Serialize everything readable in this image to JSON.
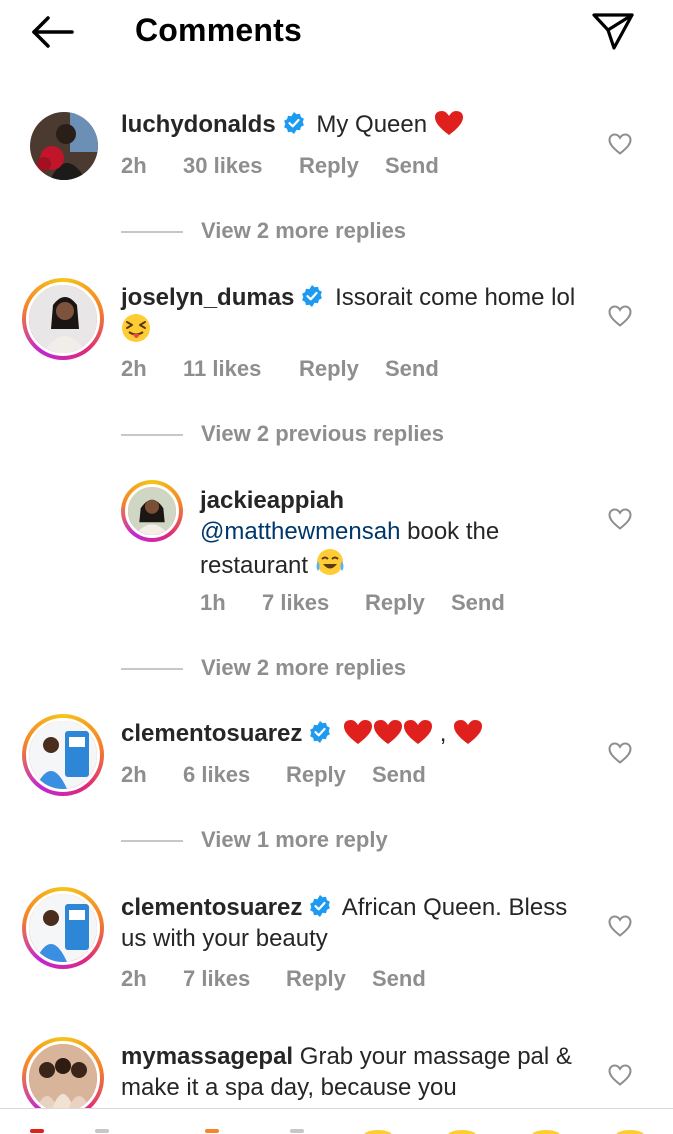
{
  "header": {
    "title": "Comments"
  },
  "comments": [
    {
      "username": "luchydonalds",
      "text": "My Queen",
      "time": "2h",
      "likes": "30 likes",
      "reply": "Reply",
      "send": "Send",
      "view_replies": "View 2 more replies"
    },
    {
      "username": "joselyn_dumas",
      "text": "Issorait come home lol",
      "time": "2h",
      "likes": "11 likes",
      "reply": "Reply",
      "send": "Send",
      "view_replies": "View 2 previous replies"
    },
    {
      "username": "jackieappiah",
      "mention": "@matthewmensah",
      "text": "book the restaurant",
      "time": "1h",
      "likes": "7 likes",
      "reply": "Reply",
      "send": "Send",
      "view_replies": "View 2 more replies"
    },
    {
      "username": "clementosuarez",
      "text": ",",
      "time": "2h",
      "likes": "6 likes",
      "reply": "Reply",
      "send": "Send",
      "view_replies": "View 1 more reply"
    },
    {
      "username": "clementosuarez",
      "text": "African Queen. Bless us with your beauty",
      "time": "2h",
      "likes": "7 likes",
      "reply": "Reply",
      "send": "Send"
    },
    {
      "username": "mymassagepal",
      "text": "Grab your massage pal & make it a spa day, because you"
    }
  ]
}
